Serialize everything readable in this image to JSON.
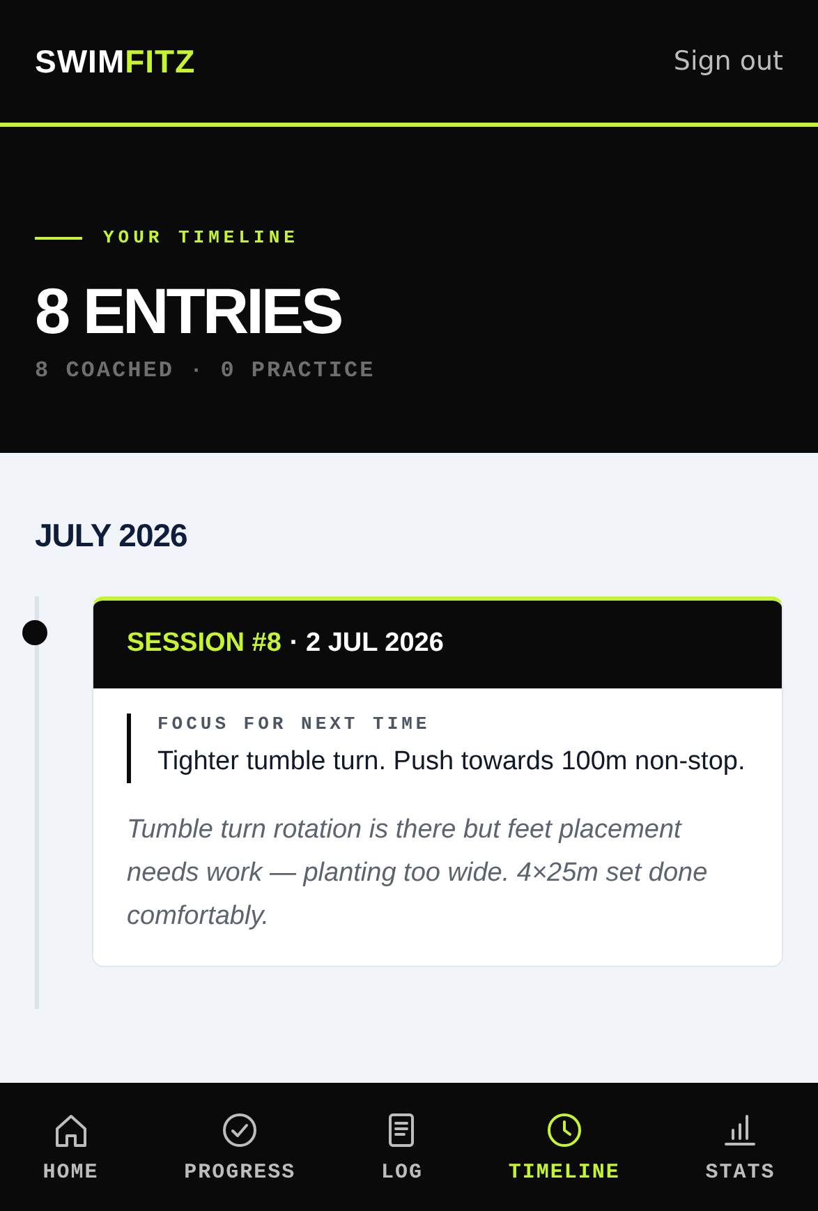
{
  "header": {
    "logo_first": "SWIM",
    "logo_second": "FITZ",
    "sign_out": "Sign out"
  },
  "hero": {
    "eyebrow": "YOUR TIMELINE",
    "title": "8 ENTRIES",
    "summary": "8 COACHED · 0 PRACTICE"
  },
  "months": [
    {
      "title": "JULY 2026",
      "entries": [
        {
          "session": "SESSION #8",
          "date": "· 2 JUL 2026",
          "focus_label": "FOCUS FOR NEXT TIME",
          "focus": "Tighter tumble turn. Push towards 100m non-stop.",
          "notes": "Tumble turn rotation is there but feet placement needs work — planting too wide. 4×25m set done comfortably."
        }
      ]
    }
  ],
  "nav": [
    {
      "kind": "home",
      "label": "HOME",
      "selected": false
    },
    {
      "kind": "progress",
      "label": "PROGRESS",
      "selected": false
    },
    {
      "kind": "log",
      "label": "LOG",
      "selected": false
    },
    {
      "kind": "timeline",
      "label": "TIMELINE",
      "selected": true
    },
    {
      "kind": "stats",
      "label": "STATS",
      "selected": false
    }
  ]
}
